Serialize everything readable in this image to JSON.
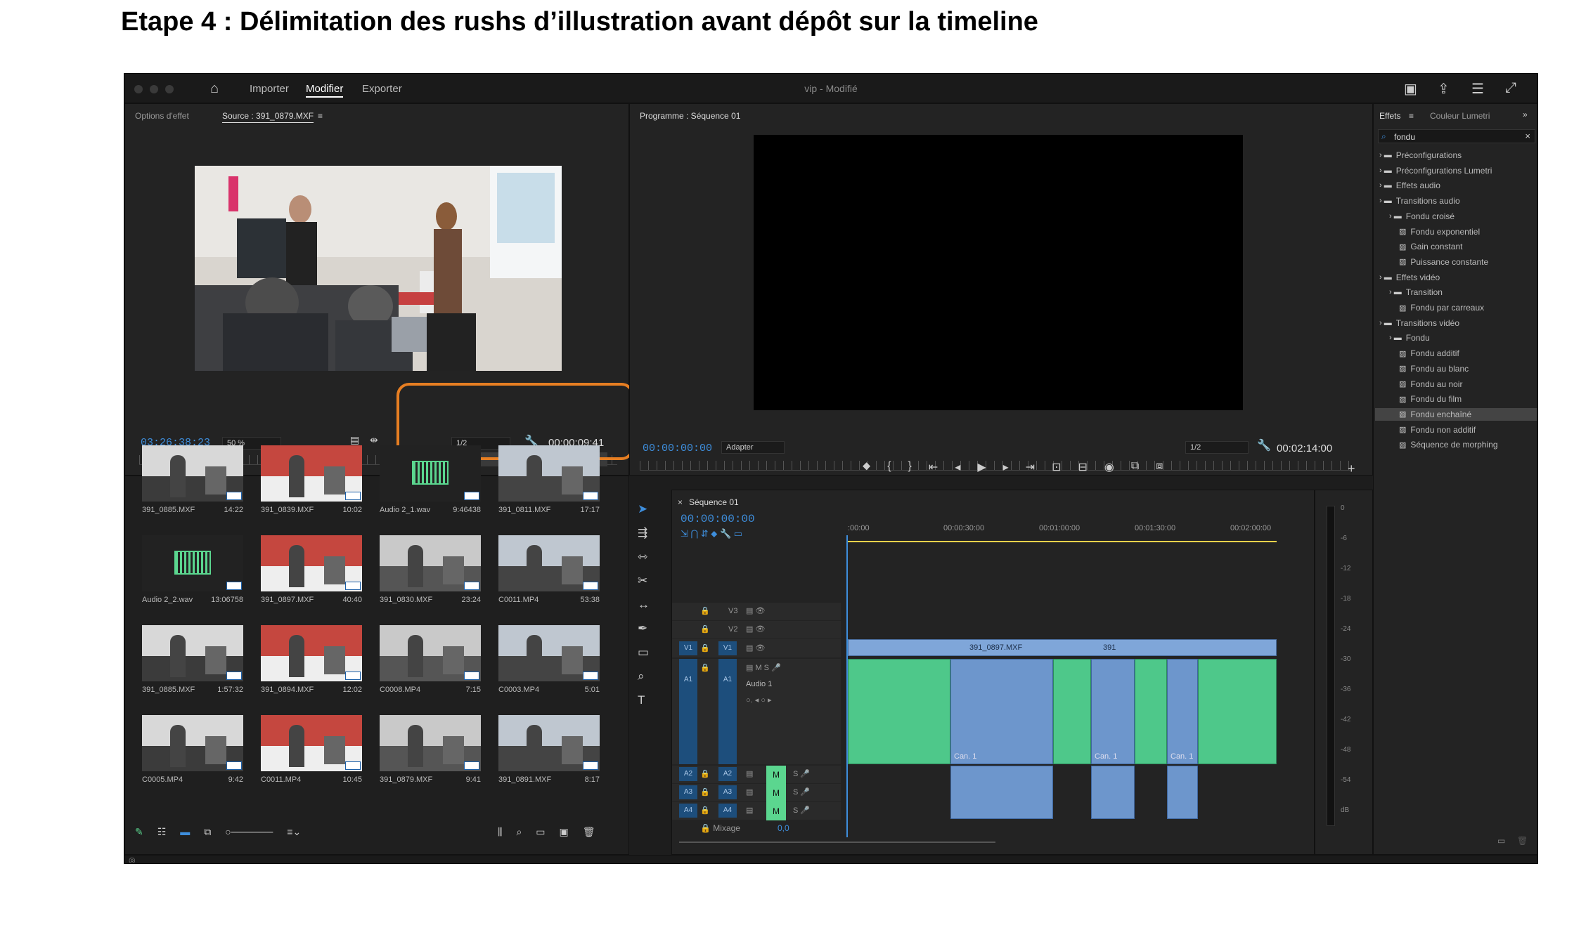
{
  "doc_title": "Etape 4 : Délimitation des rushs d’illustration avant dépôt sur la timeline",
  "app": {
    "title": "vip - Modifié",
    "workspace_tabs": [
      "Importer",
      "Modifier",
      "Exporter"
    ],
    "active_workspace": "Modifier"
  },
  "source": {
    "tab_options": "Options d'effet",
    "tab_source": "Source : 391_0879.MXF",
    "timecode": "03:26:38:23",
    "zoom": "50 %",
    "resolution": "1/2",
    "duration": "00:00:09:41"
  },
  "program": {
    "tab": "Programme : Séquence 01",
    "timecode": "00:00:00:00",
    "fit": "Adapter",
    "resolution": "1/2",
    "duration": "00:02:14:00"
  },
  "project_items": [
    {
      "name": "391_0885.MXF",
      "duration": "14:22",
      "kind": "video"
    },
    {
      "name": "391_0839.MXF",
      "duration": "10:02",
      "kind": "video"
    },
    {
      "name": "Audio 2_1.wav",
      "duration": "9:46438",
      "kind": "audio"
    },
    {
      "name": "391_0811.MXF",
      "duration": "17:17",
      "kind": "video"
    },
    {
      "name": "Audio 2_2.wav",
      "duration": "13:06758",
      "kind": "audio"
    },
    {
      "name": "391_0897.MXF",
      "duration": "40:40",
      "kind": "video"
    },
    {
      "name": "391_0830.MXF",
      "duration": "23:24",
      "kind": "video"
    },
    {
      "name": "C0011.MP4",
      "duration": "53:38",
      "kind": "video"
    },
    {
      "name": "391_0885.MXF",
      "duration": "1:57:32",
      "kind": "video"
    },
    {
      "name": "391_0894.MXF",
      "duration": "12:02",
      "kind": "video"
    },
    {
      "name": "C0008.MP4",
      "duration": "7:15",
      "kind": "video"
    },
    {
      "name": "C0003.MP4",
      "duration": "5:01",
      "kind": "video"
    },
    {
      "name": "C0005.MP4",
      "duration": "9:42",
      "kind": "video"
    },
    {
      "name": "C0011.MP4",
      "duration": "10:45",
      "kind": "video"
    },
    {
      "name": "391_0879.MXF",
      "duration": "9:41",
      "kind": "video"
    },
    {
      "name": "391_0891.MXF",
      "duration": "8:17",
      "kind": "video"
    }
  ],
  "sequence": {
    "tab": "Séquence 01",
    "timecode": "00:00:00:00",
    "ruler": [
      ":00:00",
      "00:00:30:00",
      "00:01:00:00",
      "00:01:30:00",
      "00:02:00:00"
    ],
    "video_tracks": [
      "V3",
      "V2",
      "V1"
    ],
    "audio_tracks": [
      "A1",
      "A2",
      "A3",
      "A4"
    ],
    "audio1_name": "Audio 1",
    "mix_label": "Mixage",
    "mix_value": "0,0",
    "clip_labels": [
      "391_0897.MXF",
      "391"
    ],
    "audio_clip_label": "Can. 1"
  },
  "meter_labels": [
    "0",
    "-6",
    "-12",
    "-18",
    "-24",
    "-30",
    "-36",
    "-42",
    "-48",
    "-54",
    "dB"
  ],
  "effects": {
    "tab": "Effets",
    "tab2": "Couleur Lumetri",
    "search": "fondu",
    "tree": [
      {
        "label": "Préconfigurations",
        "level": 0,
        "type": "folder"
      },
      {
        "label": "Préconfigurations Lumetri",
        "level": 0,
        "type": "folder"
      },
      {
        "label": "Effets audio",
        "level": 0,
        "type": "folder"
      },
      {
        "label": "Transitions audio",
        "level": 0,
        "type": "folder"
      },
      {
        "label": "Fondu croisé",
        "level": 1,
        "type": "folder"
      },
      {
        "label": "Fondu exponentiel",
        "level": 2,
        "type": "item"
      },
      {
        "label": "Gain constant",
        "level": 2,
        "type": "item"
      },
      {
        "label": "Puissance constante",
        "level": 2,
        "type": "item"
      },
      {
        "label": "Effets vidéo",
        "level": 0,
        "type": "folder"
      },
      {
        "label": "Transition",
        "level": 1,
        "type": "folder"
      },
      {
        "label": "Fondu par carreaux",
        "level": 2,
        "type": "item"
      },
      {
        "label": "Transitions vidéo",
        "level": 0,
        "type": "folder"
      },
      {
        "label": "Fondu",
        "level": 1,
        "type": "folder"
      },
      {
        "label": "Fondu additif",
        "level": 2,
        "type": "item"
      },
      {
        "label": "Fondu au blanc",
        "level": 2,
        "type": "item"
      },
      {
        "label": "Fondu au noir",
        "level": 2,
        "type": "item"
      },
      {
        "label": "Fondu du film",
        "level": 2,
        "type": "item"
      },
      {
        "label": "Fondu enchaîné",
        "level": 2,
        "type": "item",
        "selected": true
      },
      {
        "label": "Fondu non additif",
        "level": 2,
        "type": "item"
      },
      {
        "label": "Séquence de morphing",
        "level": 2,
        "type": "item"
      }
    ]
  },
  "colors": {
    "timecode": "#3e8edc",
    "highlight": "#e67e22",
    "audio_clip": "#4ec88a",
    "video_clip": "#7fa6d9"
  }
}
